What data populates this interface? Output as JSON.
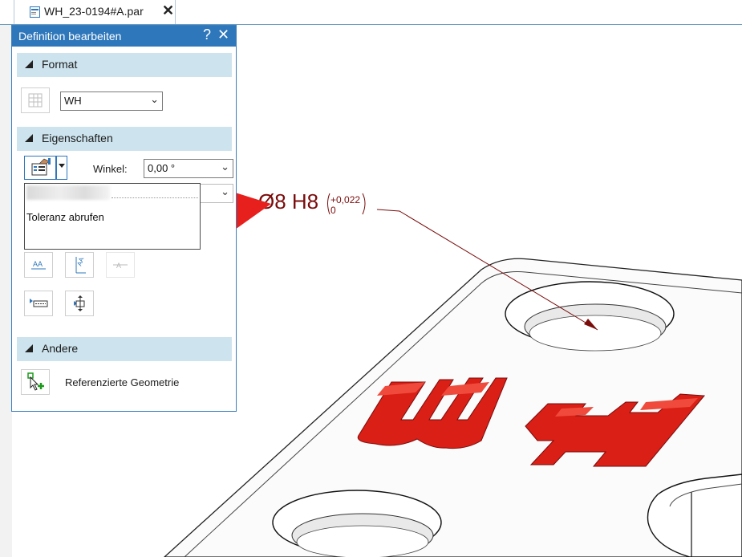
{
  "document_tab": {
    "title": "WH_23-0194#A.par",
    "close_glyph": "✕"
  },
  "panel": {
    "title": "Definition bearbeiten",
    "help_glyph": "?",
    "close_glyph": "✕",
    "sections": {
      "format": {
        "label": "Format",
        "style_value": "WH"
      },
      "eigenschaften": {
        "label": "Eigenschaften",
        "angle_label": "Winkel:",
        "angle_value": "0,00 °"
      },
      "andere": {
        "label": "Andere",
        "referenced_geometry_label": "Referenzierte Geometrie"
      }
    },
    "popup": {
      "item": "Toleranz abrufen"
    }
  },
  "callout": {
    "dimension": "Ø8 H8",
    "upper_tolerance": "+0,022",
    "lower_tolerance": "0"
  },
  "colors": {
    "accent": "#2e77bb",
    "section_bg": "#cde4ee",
    "annotation": "#7a0c0c",
    "arrow": "#e8201d",
    "emboss_red": "#d91f16"
  },
  "icons": [
    "document-icon",
    "table-format-icon",
    "tolerance-tool-icon",
    "dropdown-arrow-icon",
    "text-align-icon",
    "vertical-text-icon",
    "strike-text-icon",
    "leader-left-icon",
    "leader-both-icon",
    "referenced-geometry-icon"
  ]
}
